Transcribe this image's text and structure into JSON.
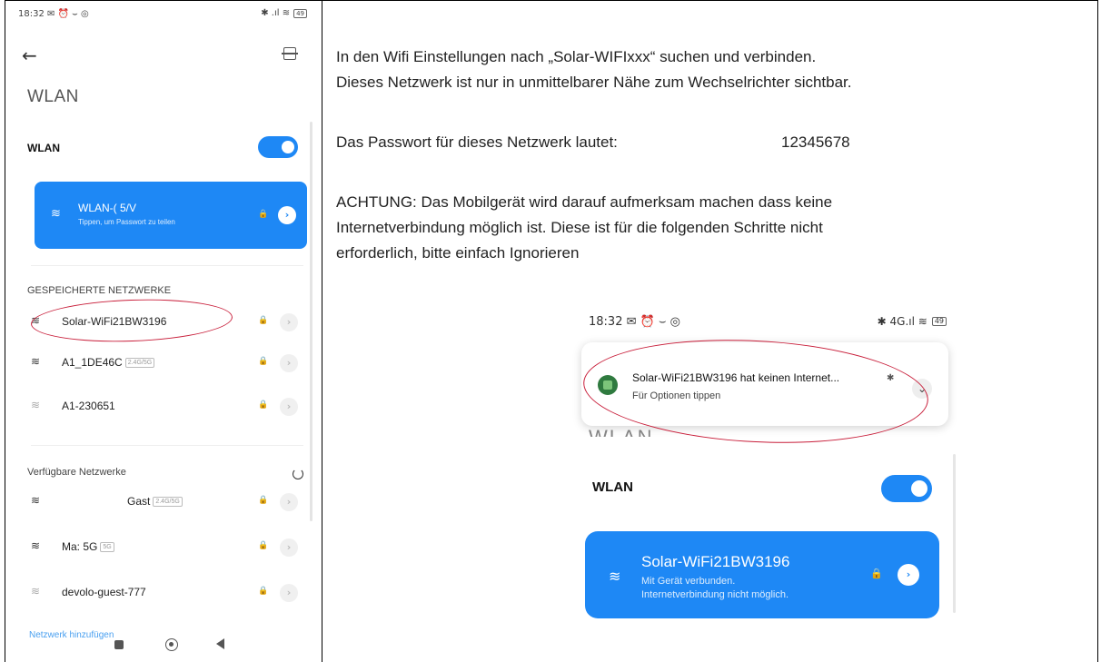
{
  "left_phone": {
    "status_time": "18:32 ✉ ⏰ ⌣ ◎",
    "status_icons": "✱ .ıl ≋",
    "battery": "49",
    "title": "WLAN",
    "wlan_toggle_label": "WLAN",
    "connected": {
      "name": "WLAN-(     5/V",
      "sub": "Tippen, um Passwort zu teilen"
    },
    "saved_section": "GESPEICHERTE NETZWERKE",
    "saved_networks": [
      {
        "name": "Solar-WiFi21BW3196",
        "badge": ""
      },
      {
        "name": "A1_1DE46C",
        "badge": "2.4G/5G"
      },
      {
        "name": "A1-230651",
        "badge": ""
      }
    ],
    "available_section": "Verfügbare Netzwerke",
    "available_networks": [
      {
        "name": "Gast",
        "badge": "2.4G/5G"
      },
      {
        "name": "Ma:            5G",
        "badge": "5G"
      },
      {
        "name": "devolo-guest-777",
        "badge": ""
      }
    ],
    "add_network": "Netzwerk hinzufügen"
  },
  "instructions": {
    "line1": "In den Wifi Einstellungen nach „Solar-WIFIxxx“ suchen und verbinden.",
    "line2": "Dieses Netzwerk ist nur in unmittelbarer Nähe zum Wechselrichter sichtbar.",
    "password_label": "Das Passwort für dieses Netzwerk lautet:",
    "password_value": "12345678",
    "warning_line1": "ACHTUNG: Das Mobilgerät wird darauf aufmerksam machen dass keine",
    "warning_line2": "Internetverbindung möglich ist. Diese ist für die folgenden Schritte nicht",
    "warning_line3": "erforderlich, bitte einfach Ignorieren"
  },
  "right_phone": {
    "status_time": "18:32 ✉ ⏰ ⌣ ◎",
    "status_icons": "✱ 4G.ıl ≋",
    "battery": "49",
    "notification_title": "Solar-WiFi21BW3196 hat keinen Internet...",
    "notification_sub": "Für Optionen tippen",
    "wlan_partial": "WLAN",
    "wlan_toggle_label": "WLAN",
    "connected_name": "Solar-WiFi21BW3196",
    "connected_sub1": "Mit Gerät verbunden.",
    "connected_sub2": "Internetverbindung nicht möglich."
  },
  "colors": {
    "accent": "#1e88f5",
    "annotation": "#c81e3a"
  }
}
